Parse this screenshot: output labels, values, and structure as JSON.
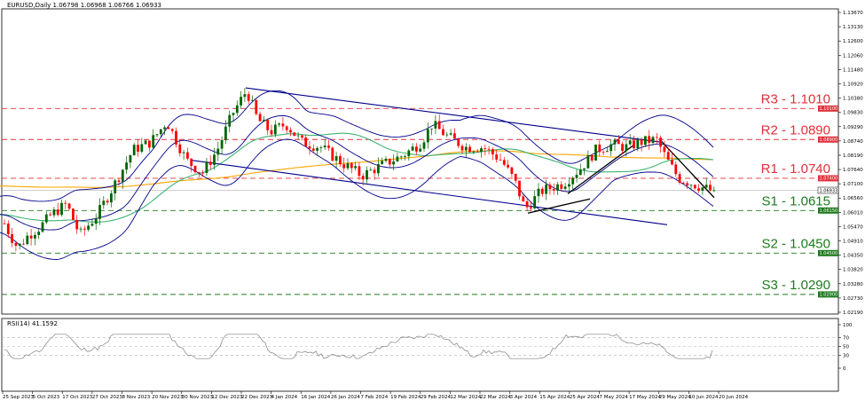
{
  "chart_data": {
    "type": "candlestick",
    "title": "EURUSD,Daily  1.06798 1.06968 1.06766 1.06933",
    "y_axis_ticks": [
      "1.13670",
      "1.13130",
      "1.12600",
      "1.12060",
      "1.11480",
      "1.10920",
      "1.10380",
      "1.09830",
      "1.09290",
      "1.08740",
      "1.08190",
      "1.07640",
      "1.07100",
      "1.06560",
      "1.06010",
      "1.05470",
      "1.04910",
      "1.04350",
      "1.03820",
      "1.03280",
      "1.02730",
      "1.02190"
    ],
    "ylim": [
      1.0214,
      1.1396
    ],
    "x_axis_ticks": [
      "25 Sep 2023",
      "5 Oct 2023",
      "17 Oct 2023",
      "27 Oct 2023",
      "8 Nov 2023",
      "20 Nov 2023",
      "30 Nov 2023",
      "12 Dec 2023",
      "22 Dec 2023",
      "4 Jan 2024",
      "16 Jan 2024",
      "26 Jan 2024",
      "7 Feb 2024",
      "19 Feb 2024",
      "29 Feb 2024",
      "12 Mar 2024",
      "22 Mar 2024",
      "3 Apr 2024",
      "15 Apr 2024",
      "25 Apr 2024",
      "7 May 2024",
      "17 May 2024",
      "29 May 2024",
      "10 Jun 2024",
      "20 Jun 2024"
    ],
    "current_price": "1.06933",
    "levels": [
      {
        "label": "R3 - 1.1010",
        "tag": "1.10100",
        "value": 1.101,
        "kind": "resistance"
      },
      {
        "label": "R2 - 1.0890",
        "tag": "1.08900",
        "value": 1.089,
        "kind": "resistance"
      },
      {
        "label": "R1 - 1.0740",
        "tag": "1.07400",
        "value": 1.074,
        "kind": "resistance"
      },
      {
        "label": "S1 - 1.0615",
        "tag": "1.06150",
        "value": 1.0615,
        "kind": "support"
      },
      {
        "label": "S2 - 1.0450",
        "tag": "1.04500",
        "value": 1.045,
        "kind": "support"
      },
      {
        "label": "S3 - 1.0290",
        "tag": "1.02900",
        "value": 1.029,
        "kind": "support"
      }
    ],
    "rsi": {
      "title": "RSI(14) 41.1592",
      "ticks": [
        "100",
        "70",
        "50",
        "30",
        "0"
      ],
      "ylim": [
        0,
        100
      ],
      "levels": [
        70,
        50,
        30
      ]
    },
    "colors": {
      "bull": "#006400",
      "bear": "#ff0000",
      "resistance": "#e0303a",
      "support": "#1e7a1e",
      "band": "#00008b",
      "ma_fast": "#3cb371",
      "ma_slow": "#ffa500",
      "rsi_line": "#808080"
    }
  }
}
